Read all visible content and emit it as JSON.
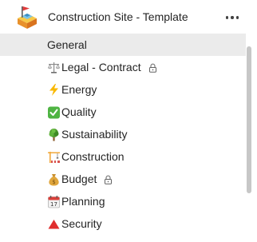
{
  "team": {
    "name": "Construction Site - Template",
    "icon": "construction-site-team-icon",
    "more_icon": "more-horizontal-icon"
  },
  "channels": [
    {
      "label": "General",
      "emoji": "",
      "locked": false,
      "selected": true
    },
    {
      "label": "Legal - Contract",
      "emoji": "scales-icon",
      "locked": true,
      "selected": false
    },
    {
      "label": "Energy",
      "emoji": "lightning-icon",
      "locked": false,
      "selected": false
    },
    {
      "label": "Quality",
      "emoji": "check-mark-button-icon",
      "locked": false,
      "selected": false
    },
    {
      "label": "Sustainability",
      "emoji": "deciduous-tree-icon",
      "locked": false,
      "selected": false
    },
    {
      "label": "Construction",
      "emoji": "construction-crane-icon",
      "locked": false,
      "selected": false
    },
    {
      "label": "Budget",
      "emoji": "money-bag-icon",
      "locked": true,
      "selected": false
    },
    {
      "label": "Planning",
      "emoji": "calendar-icon",
      "locked": false,
      "selected": false
    },
    {
      "label": "Security",
      "emoji": "red-triangle-icon",
      "locked": false,
      "selected": false
    }
  ],
  "colors": {
    "selected_background": "#ebebeb",
    "text": "#242424",
    "scrollbar": "#c7c7c7"
  }
}
